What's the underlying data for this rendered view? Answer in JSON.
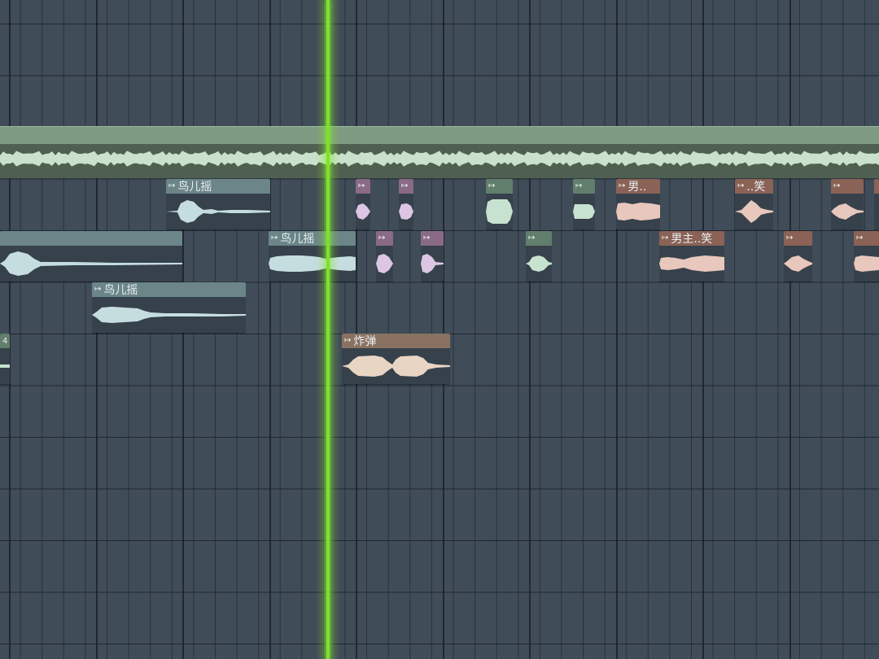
{
  "colors": {
    "background": "#404c58",
    "playhead": "#7fe02c",
    "wave_teal": "#c6dde0",
    "wave_mint": "#c7e3cf",
    "wave_pink": "#dcc6e3",
    "wave_rose": "#e8c7bd",
    "wave_sand": "#e9d5c4"
  },
  "playhead": {
    "icon": "playhead-marker"
  },
  "clips": [
    {
      "label": "鸟儿摇",
      "color": "teal"
    },
    {
      "label": "",
      "color": "teal"
    },
    {
      "label": "鸟儿摇",
      "color": "teal"
    },
    {
      "label": "鸟儿摇",
      "color": "teal"
    },
    {
      "label": "",
      "color": "pink"
    },
    {
      "label": "",
      "color": "pink"
    },
    {
      "label": "",
      "color": "mint"
    },
    {
      "label": "",
      "color": "mint"
    },
    {
      "label": "男..",
      "color": "rose"
    },
    {
      "label": "..笑",
      "color": "rose"
    },
    {
      "label": "",
      "color": "rose"
    },
    {
      "label": "",
      "color": "pink"
    },
    {
      "label": "",
      "color": "pink"
    },
    {
      "label": "",
      "color": "mint"
    },
    {
      "label": "男主..笑",
      "color": "rose"
    },
    {
      "label": "",
      "color": "rose"
    },
    {
      "label": "",
      "color": "rose"
    },
    {
      "label": "炸弹",
      "color": "sand"
    },
    {
      "label": "4",
      "color": "mint"
    }
  ]
}
